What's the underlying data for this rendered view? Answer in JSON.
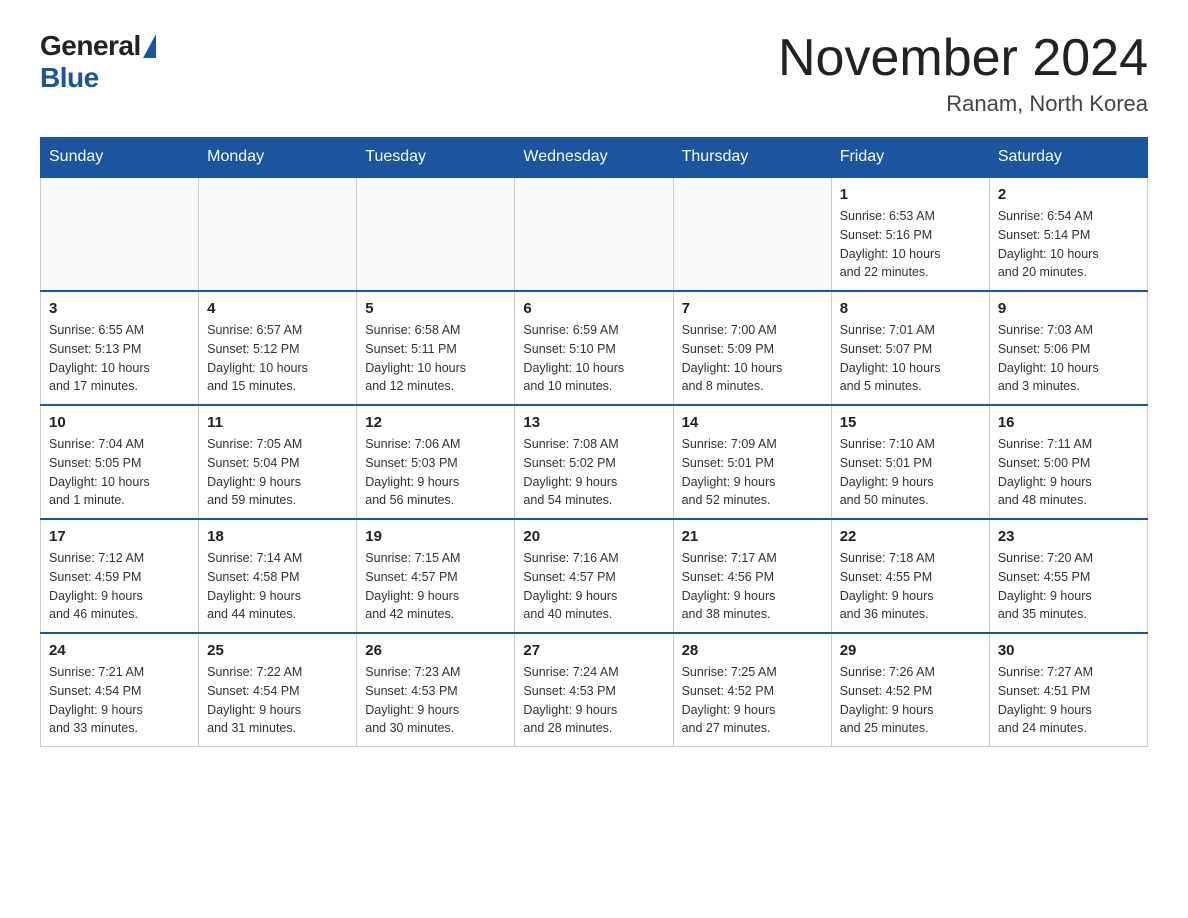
{
  "logo": {
    "general": "General",
    "blue": "Blue"
  },
  "title": "November 2024",
  "location": "Ranam, North Korea",
  "days_of_week": [
    "Sunday",
    "Monday",
    "Tuesday",
    "Wednesday",
    "Thursday",
    "Friday",
    "Saturday"
  ],
  "weeks": [
    [
      {
        "day": "",
        "info": ""
      },
      {
        "day": "",
        "info": ""
      },
      {
        "day": "",
        "info": ""
      },
      {
        "day": "",
        "info": ""
      },
      {
        "day": "",
        "info": ""
      },
      {
        "day": "1",
        "info": "Sunrise: 6:53 AM\nSunset: 5:16 PM\nDaylight: 10 hours\nand 22 minutes."
      },
      {
        "day": "2",
        "info": "Sunrise: 6:54 AM\nSunset: 5:14 PM\nDaylight: 10 hours\nand 20 minutes."
      }
    ],
    [
      {
        "day": "3",
        "info": "Sunrise: 6:55 AM\nSunset: 5:13 PM\nDaylight: 10 hours\nand 17 minutes."
      },
      {
        "day": "4",
        "info": "Sunrise: 6:57 AM\nSunset: 5:12 PM\nDaylight: 10 hours\nand 15 minutes."
      },
      {
        "day": "5",
        "info": "Sunrise: 6:58 AM\nSunset: 5:11 PM\nDaylight: 10 hours\nand 12 minutes."
      },
      {
        "day": "6",
        "info": "Sunrise: 6:59 AM\nSunset: 5:10 PM\nDaylight: 10 hours\nand 10 minutes."
      },
      {
        "day": "7",
        "info": "Sunrise: 7:00 AM\nSunset: 5:09 PM\nDaylight: 10 hours\nand 8 minutes."
      },
      {
        "day": "8",
        "info": "Sunrise: 7:01 AM\nSunset: 5:07 PM\nDaylight: 10 hours\nand 5 minutes."
      },
      {
        "day": "9",
        "info": "Sunrise: 7:03 AM\nSunset: 5:06 PM\nDaylight: 10 hours\nand 3 minutes."
      }
    ],
    [
      {
        "day": "10",
        "info": "Sunrise: 7:04 AM\nSunset: 5:05 PM\nDaylight: 10 hours\nand 1 minute."
      },
      {
        "day": "11",
        "info": "Sunrise: 7:05 AM\nSunset: 5:04 PM\nDaylight: 9 hours\nand 59 minutes."
      },
      {
        "day": "12",
        "info": "Sunrise: 7:06 AM\nSunset: 5:03 PM\nDaylight: 9 hours\nand 56 minutes."
      },
      {
        "day": "13",
        "info": "Sunrise: 7:08 AM\nSunset: 5:02 PM\nDaylight: 9 hours\nand 54 minutes."
      },
      {
        "day": "14",
        "info": "Sunrise: 7:09 AM\nSunset: 5:01 PM\nDaylight: 9 hours\nand 52 minutes."
      },
      {
        "day": "15",
        "info": "Sunrise: 7:10 AM\nSunset: 5:01 PM\nDaylight: 9 hours\nand 50 minutes."
      },
      {
        "day": "16",
        "info": "Sunrise: 7:11 AM\nSunset: 5:00 PM\nDaylight: 9 hours\nand 48 minutes."
      }
    ],
    [
      {
        "day": "17",
        "info": "Sunrise: 7:12 AM\nSunset: 4:59 PM\nDaylight: 9 hours\nand 46 minutes."
      },
      {
        "day": "18",
        "info": "Sunrise: 7:14 AM\nSunset: 4:58 PM\nDaylight: 9 hours\nand 44 minutes."
      },
      {
        "day": "19",
        "info": "Sunrise: 7:15 AM\nSunset: 4:57 PM\nDaylight: 9 hours\nand 42 minutes."
      },
      {
        "day": "20",
        "info": "Sunrise: 7:16 AM\nSunset: 4:57 PM\nDaylight: 9 hours\nand 40 minutes."
      },
      {
        "day": "21",
        "info": "Sunrise: 7:17 AM\nSunset: 4:56 PM\nDaylight: 9 hours\nand 38 minutes."
      },
      {
        "day": "22",
        "info": "Sunrise: 7:18 AM\nSunset: 4:55 PM\nDaylight: 9 hours\nand 36 minutes."
      },
      {
        "day": "23",
        "info": "Sunrise: 7:20 AM\nSunset: 4:55 PM\nDaylight: 9 hours\nand 35 minutes."
      }
    ],
    [
      {
        "day": "24",
        "info": "Sunrise: 7:21 AM\nSunset: 4:54 PM\nDaylight: 9 hours\nand 33 minutes."
      },
      {
        "day": "25",
        "info": "Sunrise: 7:22 AM\nSunset: 4:54 PM\nDaylight: 9 hours\nand 31 minutes."
      },
      {
        "day": "26",
        "info": "Sunrise: 7:23 AM\nSunset: 4:53 PM\nDaylight: 9 hours\nand 30 minutes."
      },
      {
        "day": "27",
        "info": "Sunrise: 7:24 AM\nSunset: 4:53 PM\nDaylight: 9 hours\nand 28 minutes."
      },
      {
        "day": "28",
        "info": "Sunrise: 7:25 AM\nSunset: 4:52 PM\nDaylight: 9 hours\nand 27 minutes."
      },
      {
        "day": "29",
        "info": "Sunrise: 7:26 AM\nSunset: 4:52 PM\nDaylight: 9 hours\nand 25 minutes."
      },
      {
        "day": "30",
        "info": "Sunrise: 7:27 AM\nSunset: 4:51 PM\nDaylight: 9 hours\nand 24 minutes."
      }
    ]
  ]
}
